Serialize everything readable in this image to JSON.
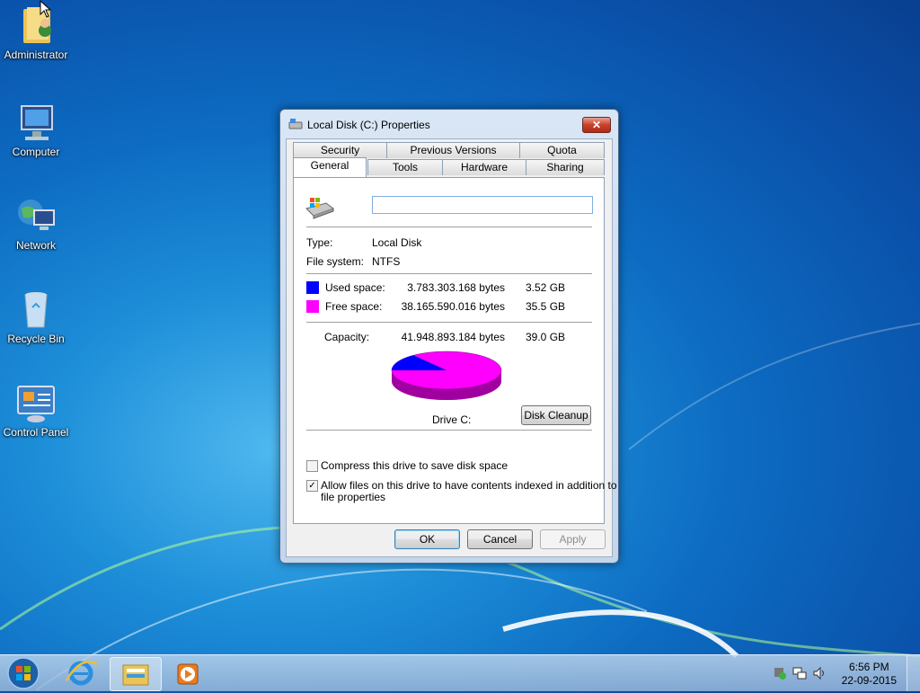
{
  "desktop": {
    "icons": [
      {
        "label": "Administrator"
      },
      {
        "label": "Computer"
      },
      {
        "label": "Network"
      },
      {
        "label": "Recycle Bin"
      },
      {
        "label": "Control Panel"
      }
    ]
  },
  "dialog": {
    "title": "Local Disk (C:) Properties",
    "close_label": "✕",
    "tabs_row1": [
      "Security",
      "Previous Versions",
      "Quota"
    ],
    "tabs_row2": [
      "General",
      "Tools",
      "Hardware",
      "Sharing"
    ],
    "selected_tab": "General",
    "drive_name_value": "",
    "type_label": "Type:",
    "type_value": "Local Disk",
    "fs_label": "File system:",
    "fs_value": "NTFS",
    "used_label": "Used space:",
    "used_bytes": "3.783.303.168 bytes",
    "used_gb": "3.52 GB",
    "free_label": "Free space:",
    "free_bytes": "38.165.590.016 bytes",
    "free_gb": "35.5 GB",
    "capacity_label": "Capacity:",
    "capacity_bytes": "41.948.893.184 bytes",
    "capacity_gb": "39.0 GB",
    "drive_label": "Drive C:",
    "disk_cleanup_label": "Disk Cleanup",
    "compress_label": "Compress this drive to save disk space",
    "compress_checked": false,
    "index_label_1": "Allow files on this drive to have contents indexed in addition to",
    "index_label_2": "file properties",
    "index_checked": true,
    "ok_label": "OK",
    "cancel_label": "Cancel",
    "apply_label": "Apply",
    "colors": {
      "used": "#0000ff",
      "free": "#ff00ff"
    }
  },
  "taskbar": {
    "clock_time": "6:56 PM",
    "clock_date": "22-09-2015"
  }
}
